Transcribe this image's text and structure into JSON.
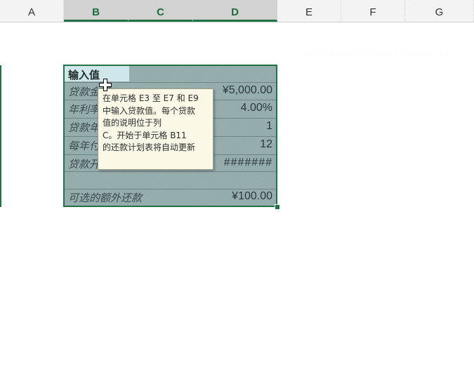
{
  "columns": [
    "A",
    "B",
    "C",
    "D",
    "E",
    "F",
    "G"
  ],
  "selected_columns": [
    "B",
    "C",
    "D"
  ],
  "table": {
    "header": "输入值",
    "rows": [
      {
        "label": "贷款金额",
        "value": "¥5,000.00"
      },
      {
        "label": "年利率",
        "value": "4.00%"
      },
      {
        "label": "贷款年限",
        "value": "1"
      },
      {
        "label": "每年付款次数",
        "value": "12"
      },
      {
        "label": "贷款开始日期",
        "value": "#######"
      },
      {
        "label": "",
        "value": ""
      },
      {
        "label": "可选的额外还款",
        "value": "¥100.00"
      }
    ]
  },
  "tooltip": {
    "lines": [
      "在单元格 E3 至 E7 和 E9",
      "中输入贷款值。每个贷款",
      "值的说明位于列",
      "C。开始于单元格 B11",
      "的还款计划表将自动更新"
    ]
  },
  "colors": {
    "accent": "#217346",
    "table_fill": "#93abab",
    "tooltip_bg": "#fbf8e8"
  }
}
